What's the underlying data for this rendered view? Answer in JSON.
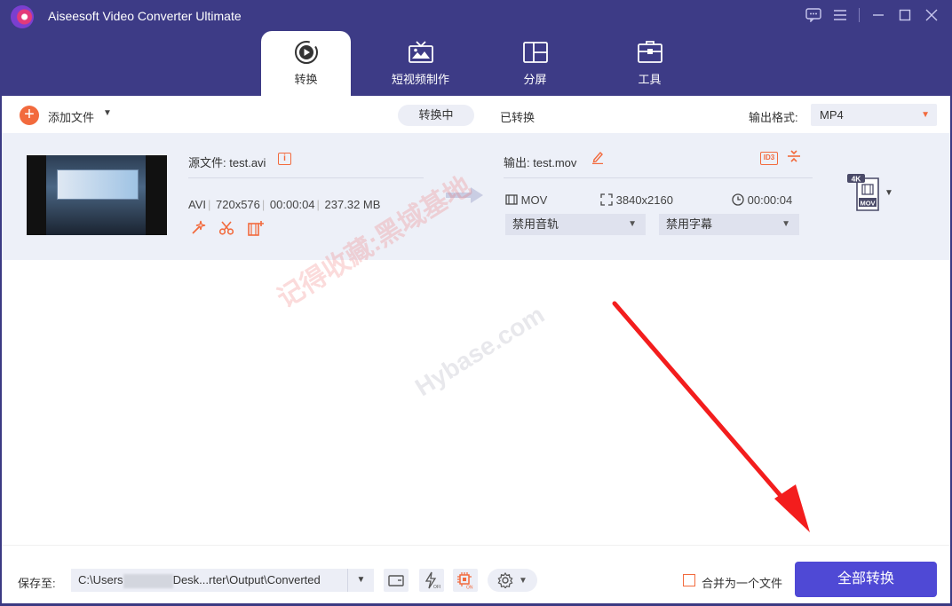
{
  "app": {
    "title": "Aiseesoft Video Converter Ultimate",
    "window_controls": [
      "feedback-icon",
      "menu-icon",
      "minimize-icon",
      "maximize-icon",
      "close-icon"
    ]
  },
  "tabs": [
    {
      "label": "转换",
      "icon": "convert-icon",
      "active": true
    },
    {
      "label": "短视频制作",
      "icon": "tv-icon",
      "active": false
    },
    {
      "label": "分屏",
      "icon": "split-screen-icon",
      "active": false
    },
    {
      "label": "工具",
      "icon": "toolbox-icon",
      "active": false
    }
  ],
  "toolbar": {
    "add_file_label": "添加文件",
    "segment_converting": "转换中",
    "segment_converted": "已转换",
    "output_format_label": "输出格式:",
    "output_format_value": "MP4"
  },
  "file": {
    "source_label": "源文件:",
    "source_name": "test.avi",
    "format": "AVI",
    "resolution": "720x576",
    "duration": "00:00:04",
    "size": "237.32 MB",
    "output_label": "输出:",
    "output_name": "test.mov",
    "output_format": "MOV",
    "output_resolution": "3840x2160",
    "output_duration": "00:00:04",
    "audio_track": "禁用音轨",
    "subtitle": "禁用字幕",
    "badge_top": "4K",
    "badge_bottom": "MOV"
  },
  "bottom": {
    "save_to_label": "保存至:",
    "path_prefix": "C:\\Users",
    "path_suffix": "Desk...rter\\Output\\Converted",
    "merge_label": "合并为一个文件",
    "convert_all_label": "全部转换"
  },
  "watermark": {
    "text_cn": "记得收藏:黑域基地",
    "text_en": "Hybase.com"
  },
  "colors": {
    "titlebar": "#3d3b86",
    "accent_orange": "#f26a3d",
    "primary_button": "#4f49d5",
    "row_bg": "#edf0f8"
  }
}
